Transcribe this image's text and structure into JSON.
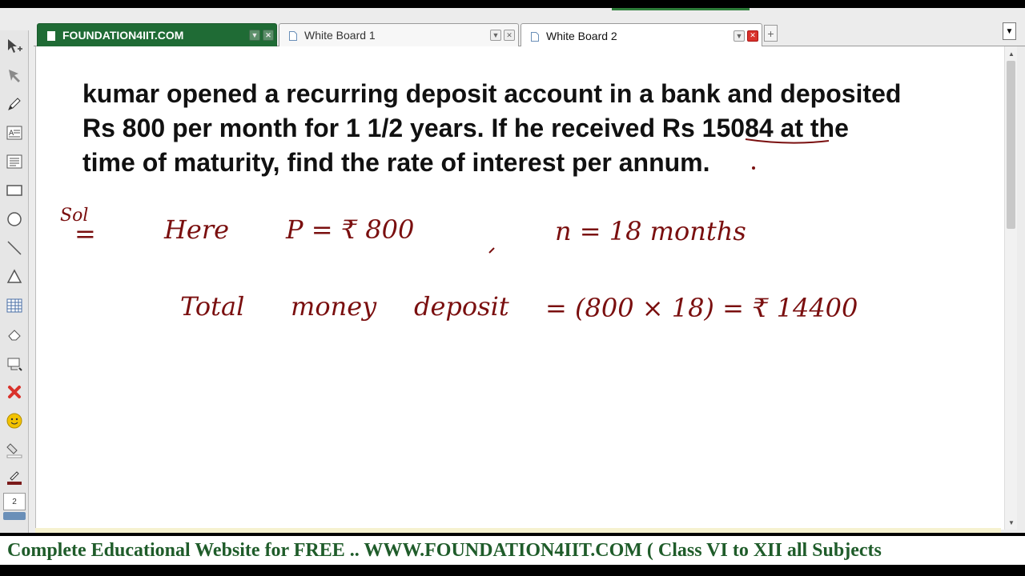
{
  "tabs": [
    {
      "label": "FOUNDATION4IIT.COM",
      "active": false
    },
    {
      "label": "White Board 1",
      "active": false
    },
    {
      "label": "White Board 2",
      "active": true
    }
  ],
  "tab_controls": {
    "dropdown": "▼",
    "close": "✕",
    "add": "+",
    "menu": "▼"
  },
  "toolbar": {
    "tools": [
      "select-arrow-icon",
      "pointer-icon",
      "pen-icon",
      "text-icon",
      "text-box-icon",
      "rectangle-icon",
      "circle-icon",
      "line-icon",
      "triangle-icon",
      "table-icon",
      "eraser-icon",
      "screenshot-icon",
      "delete-icon",
      "smiley-icon",
      "fill-icon",
      "pen-color-icon"
    ],
    "page_number": "2",
    "colors": {
      "delete": "#d9322b",
      "pen": "#7a1a1a",
      "smiley": "#f2c200"
    }
  },
  "question": {
    "line1": "kumar opened a recurring deposit account in a bank and deposited",
    "line2": "Rs 800 per month for 1 1/2 years. If he received Rs 15084 at the",
    "line3": "time of maturity, find the rate of interest per annum."
  },
  "handwriting": {
    "label_sol": "Sol",
    "eq_sign": "=",
    "line1_a": "Here",
    "line1_b": "P = ₹ 800",
    "line1_c": "n = 18 months",
    "line2_a": "Total",
    "line2_b": "money",
    "line2_c": "deposit",
    "line2_d": "= (800 × 18) = ₹ 14400",
    "ink_color": "#7a0f0f"
  },
  "footer": {
    "text": "Complete Educational Website for FREE ..  WWW.FOUNDATION4IIT.COM ( Class VI to XII all Subjects"
  }
}
